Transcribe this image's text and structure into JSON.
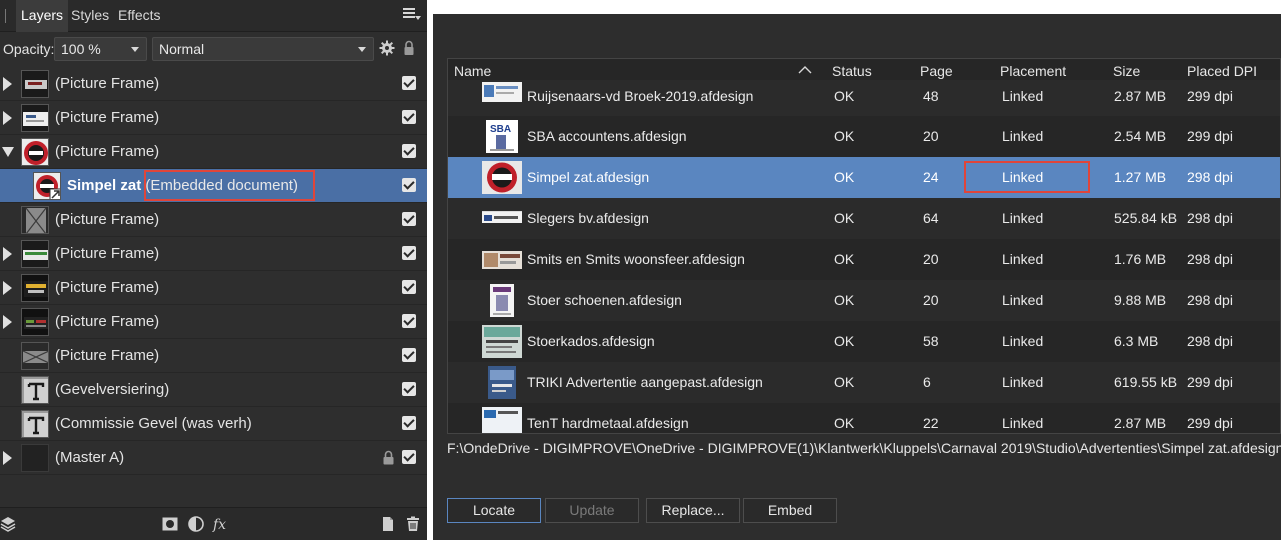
{
  "layers_panel": {
    "tabs": [
      "Layers",
      "Styles",
      "Effects"
    ],
    "opacity_label": "Opacity:",
    "opacity_value": "100 %",
    "blend_mode": "Normal",
    "layers": [
      {
        "name": "(Picture Frame)",
        "expander": "collapsed",
        "thumb": "tile-dark-logo",
        "checked": true
      },
      {
        "name": "(Picture Frame)",
        "expander": "collapsed",
        "thumb": "tile-white-ad",
        "checked": true
      },
      {
        "name": "(Picture Frame)",
        "expander": "expanded",
        "thumb": "tile-red-badge",
        "checked": true
      },
      {
        "name": "Simpel zat",
        "sub": "(Embedded document)",
        "child": true,
        "selected": true,
        "thumb": "tile-red-badge-link",
        "checked": true
      },
      {
        "name": "(Picture Frame)",
        "expander": "none",
        "thumb": "tile-empty-x",
        "checked": true
      },
      {
        "name": "(Picture Frame)",
        "expander": "collapsed",
        "thumb": "tile-green-ad",
        "checked": true
      },
      {
        "name": "(Picture Frame)",
        "expander": "collapsed",
        "thumb": "tile-yellow-ad",
        "checked": true
      },
      {
        "name": "(Picture Frame)",
        "expander": "collapsed",
        "thumb": "tile-dark-ad",
        "checked": true
      },
      {
        "name": "(Picture Frame)",
        "expander": "none",
        "thumb": "tile-empty-x-wide",
        "checked": true
      },
      {
        "name": "(Gevelversiering)",
        "expander": "none",
        "thumb": "text-T",
        "checked": true
      },
      {
        "name": "(Commissie Gevel (was verh)",
        "expander": "none",
        "thumb": "text-T",
        "checked": true
      },
      {
        "name": "(Master A)",
        "expander": "collapsed",
        "thumb": "blank",
        "checked": true,
        "locked": true
      }
    ]
  },
  "resource_manager": {
    "columns": [
      "Name",
      "Status",
      "Page",
      "Placement",
      "Size",
      "Placed DPI"
    ],
    "rows": [
      {
        "name": "Ruijsenaars-vd Broek-2019.afdesign",
        "status": "OK",
        "page": "48",
        "placement": "Linked",
        "size": "2.87 MB",
        "dpi": "299 dpi"
      },
      {
        "name": "SBA accountens.afdesign",
        "status": "OK",
        "page": "20",
        "placement": "Linked",
        "size": "2.54 MB",
        "dpi": "299 dpi"
      },
      {
        "name": "Simpel zat.afdesign",
        "status": "OK",
        "page": "24",
        "placement": "Linked",
        "size": "1.27 MB",
        "dpi": "298 dpi",
        "selected": true
      },
      {
        "name": "Slegers bv.afdesign",
        "status": "OK",
        "page": "64",
        "placement": "Linked",
        "size": "525.84 kB",
        "dpi": "298 dpi"
      },
      {
        "name": "Smits en Smits woonsfeer.afdesign",
        "status": "OK",
        "page": "20",
        "placement": "Linked",
        "size": "1.76 MB",
        "dpi": "298 dpi"
      },
      {
        "name": "Stoer schoenen.afdesign",
        "status": "OK",
        "page": "20",
        "placement": "Linked",
        "size": "9.88 MB",
        "dpi": "298 dpi"
      },
      {
        "name": "Stoerkados.afdesign",
        "status": "OK",
        "page": "58",
        "placement": "Linked",
        "size": "6.3 MB",
        "dpi": "298 dpi"
      },
      {
        "name": "TRIKI Advertentie aangepast.afdesign",
        "status": "OK",
        "page": "6",
        "placement": "Linked",
        "size": "619.55 kB",
        "dpi": "299 dpi"
      },
      {
        "name": "TenT hardmetaal.afdesign",
        "status": "OK",
        "page": "22",
        "placement": "Linked",
        "size": "2.87 MB",
        "dpi": "299 dpi"
      }
    ],
    "path": "F:\\OndeDrive - DIGIMPROVE\\OneDrive - DIGIMPROVE(1)\\Klantwerk\\Kluppels\\Carnaval 2019\\Studio\\Advertenties\\Simpel zat.afdesign",
    "buttons": {
      "locate": "Locate",
      "update": "Update",
      "replace": "Replace...",
      "embed": "Embed"
    }
  },
  "colors": {
    "selection_layers": "#4a6fa5",
    "selection_resources": "#5a86c0",
    "highlight_box": "#e0453a"
  }
}
